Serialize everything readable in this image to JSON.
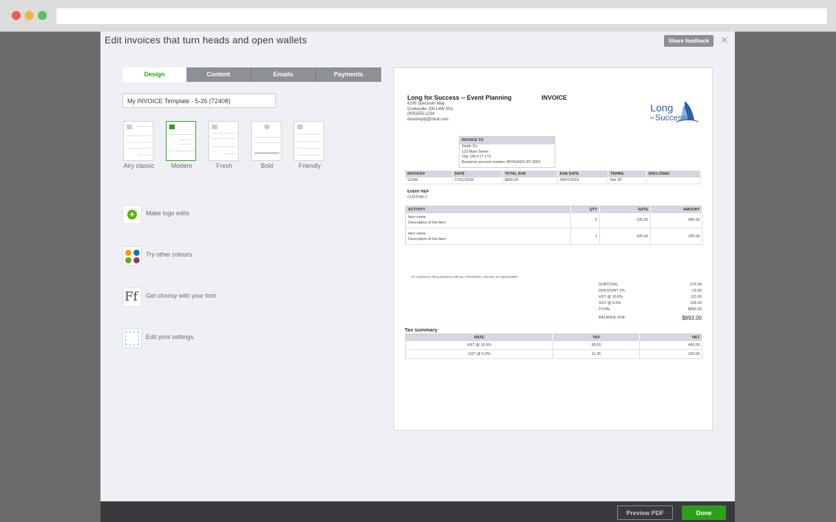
{
  "header": {
    "title": "Edit invoices that turn heads and open wallets",
    "share_feedback": "Share feedback",
    "close_glyph": "✕"
  },
  "tabs": [
    {
      "label": "Design",
      "active": true
    },
    {
      "label": "Content"
    },
    {
      "label": "Emails"
    },
    {
      "label": "Payments"
    }
  ],
  "template_name": {
    "value": "My INVOICE Template - 5-26 (72408)"
  },
  "styles": [
    {
      "label": "Airy classic"
    },
    {
      "label": "Modern",
      "selected": true
    },
    {
      "label": "Fresh"
    },
    {
      "label": "Bold"
    },
    {
      "label": "Friendly"
    }
  ],
  "options": [
    {
      "label": "Make logo edits",
      "icon": "plus-circle-icon"
    },
    {
      "label": "Try other colours",
      "icon": "palette-icon"
    },
    {
      "label": "Get choosy with your font",
      "icon": "font-icon"
    },
    {
      "label": "Edit print settings",
      "icon": "print-settings-icon"
    }
  ],
  "colors": {
    "accent": "#2ca01c",
    "palette": [
      "#f59b00",
      "#2ca01c",
      "#0077c5",
      "#9b2f7f"
    ]
  },
  "invoice": {
    "business_name": "Long for Success -- Event Planning",
    "title": "INVOICE",
    "address_lines": [
      "6100 Spectrum Way",
      "Cookeville, ON L4W 5S2",
      "(905)555-1234",
      "donotreply@intuit.com"
    ],
    "logo_text_1": "Long",
    "logo_text_2": "for",
    "logo_text_3": "Success",
    "bill_to_header": "INVOICE TO",
    "bill_to_lines": [
      "Smith Co.",
      "123 Main Street",
      "City, ON K1T 2T1",
      "Business account number 987654321 RT 0001"
    ],
    "meta_headers": [
      "INVOICE#",
      "DATE",
      "TOTAL DUE",
      "DUE DATE",
      "TERMS",
      "ENCLOSED"
    ],
    "meta_values": [
      "12345",
      "07/01/2018",
      "$865.00",
      "24/07/2018",
      "Net 30",
      ""
    ],
    "event_rep_label": "EVENT REP",
    "event_rep_value": "CUSTOM-1",
    "item_headers": [
      "ACTIVITY",
      "QTY",
      "RATE",
      "AMOUNT"
    ],
    "items": [
      {
        "name": "Item name",
        "desc": "Description of the item",
        "qty": "2",
        "rate": "225.00",
        "amount": "450.00"
      },
      {
        "name": "Item name",
        "desc": "Description of the item",
        "qty": "1",
        "rate": "225.00",
        "amount": "225.00"
      }
    ],
    "thanks": "It's a pleasure doing business with you. Remember, referrals are appreciated!",
    "totals": [
      {
        "label": "SUBTOTAL",
        "value": "675.00"
      },
      {
        "label": "DISCOUNT 2%",
        "value": "-13.50"
      },
      {
        "label": "HST @ 10.0%",
        "value": "113.00"
      },
      {
        "label": "GST @ 5.0%",
        "value": "105.00"
      },
      {
        "label": "TOTAL",
        "value": "$893.00"
      }
    ],
    "balance_label": "BALANCE DUE",
    "balance_value": "$893.00",
    "tax_title": "Tax summary",
    "tax_headers": [
      "RATE",
      "TAX",
      "NET"
    ],
    "tax_rows": [
      {
        "rate": "HST @ 10.0%",
        "tax": "90.00",
        "net": "450.00"
      },
      {
        "rate": "GST @ 5.0%",
        "tax": "11.25",
        "net": "225.00"
      }
    ]
  },
  "footer": {
    "preview_label": "Preview PDF",
    "done_label": "Done"
  }
}
